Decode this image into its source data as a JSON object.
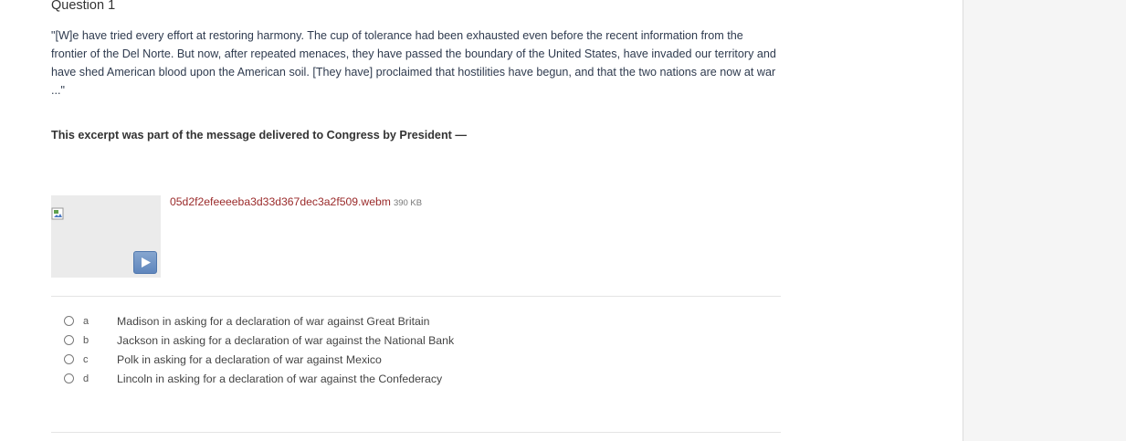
{
  "question": {
    "title": "Question 1",
    "passage": "\"[W]e have tried every effort at restoring harmony. The cup of tolerance had been exhausted even before the recent information from the frontier of the Del Norte. But now, after repeated menaces, they have passed the boundary of the United States, have invaded our territory and have shed American blood upon the American soil. [They have] proclaimed that hostilities have begun, and that the two nations are now at war ...\"",
    "prompt": "This excerpt was part of the message delivered to Congress by President —"
  },
  "media": {
    "file_name": "05d2f2efeeeeba3d33d367dec3a2f509.webm",
    "file_size": "390 KB",
    "thumbnail_icon": "broken-image-icon",
    "play_icon": "play-icon"
  },
  "choices": [
    {
      "letter": "a",
      "text": "Madison in asking for a declaration of war against Great Britain"
    },
    {
      "letter": "b",
      "text": "Jackson in asking for a declaration of war against the National Bank"
    },
    {
      "letter": "c",
      "text": "Polk in asking for a declaration of war against Mexico"
    },
    {
      "letter": "d",
      "text": "Lincoln in asking for a declaration of war against the Confederacy"
    }
  ],
  "colors": {
    "link": "#9a2a2a",
    "play_button": "#6f92c4",
    "side_panel": "#f5f5f5"
  }
}
